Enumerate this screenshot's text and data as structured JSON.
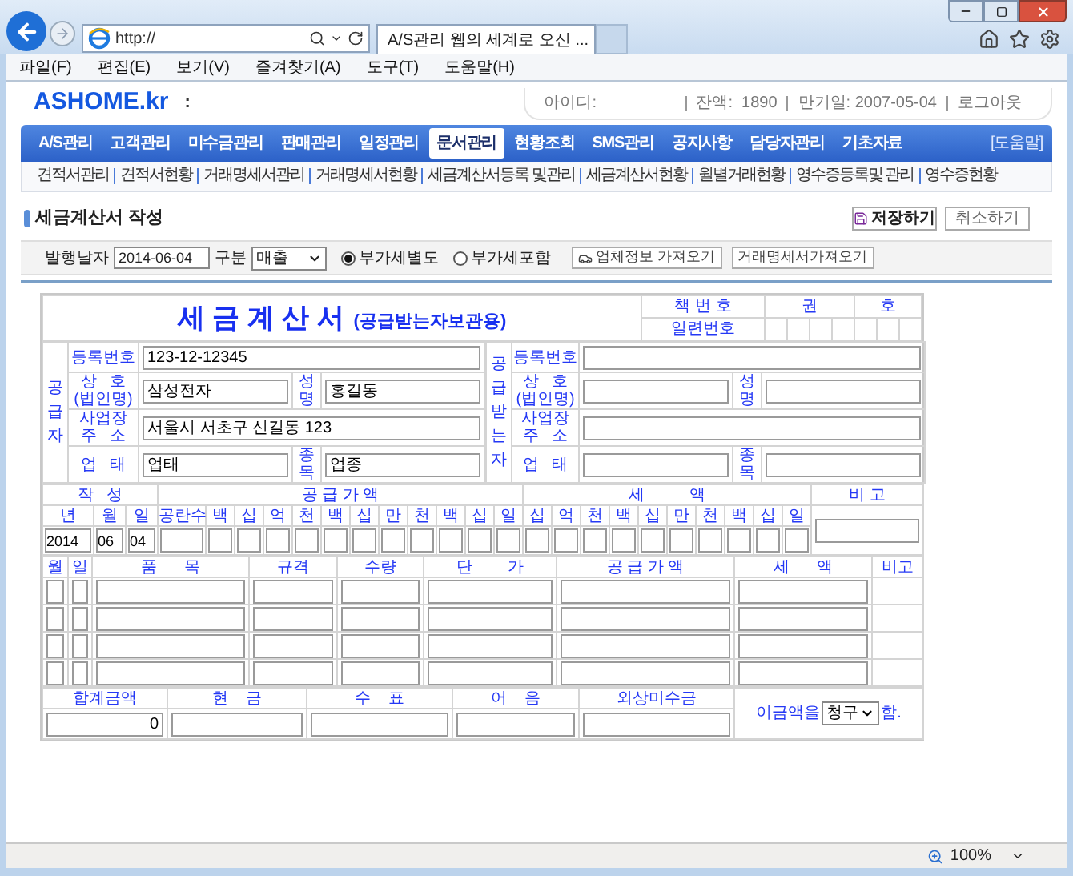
{
  "browser": {
    "address": "http://",
    "tab_title": "A/S관리 웹의 세계로 오신 ...",
    "menu": [
      "파일(F)",
      "편집(E)",
      "보기(V)",
      "즐겨찾기(A)",
      "도구(T)",
      "도움말(H)"
    ],
    "zoom": "100%"
  },
  "header": {
    "logo": "ASHOME.kr",
    "separator": ":",
    "id_label": "아이디:",
    "account": [
      "잔액:  1890",
      "만기일: 2007-05-04",
      "로그아웃"
    ]
  },
  "nav": [
    {
      "label": "A/S관리",
      "selected": false
    },
    {
      "label": "고객관리",
      "selected": false
    },
    {
      "label": "미수금관리",
      "selected": false
    },
    {
      "label": "판매관리",
      "selected": false
    },
    {
      "label": "일정관리",
      "selected": false
    },
    {
      "label": "문서관리",
      "selected": true
    },
    {
      "label": "현황조회",
      "selected": false
    },
    {
      "label": "SMS관리",
      "selected": false
    },
    {
      "label": "공지사항",
      "selected": false
    },
    {
      "label": "담당자관리",
      "selected": false
    },
    {
      "label": "기초자료",
      "selected": false
    }
  ],
  "help": "[도움말]",
  "subnav": [
    "견적서관리",
    "견적서현황",
    "거래명세서관리",
    "거래명세서현황",
    "세금계산서등록 및관리",
    "세금계산서현황",
    "월별거래현황",
    "영수증등록및 관리",
    "영수증현황"
  ],
  "page_title": "세금계산서 작성",
  "actions": [
    {
      "label": "저장하기",
      "kind": "save"
    },
    {
      "label": "취소하기",
      "kind": "plain"
    }
  ],
  "toolbar": {
    "date_label": "발행날자",
    "date": "2014-06-04",
    "type_label": "구분",
    "type": "매출",
    "vat_options": [
      {
        "label": "부가세별도",
        "selected": true
      },
      {
        "label": "부가세포함",
        "selected": false
      }
    ],
    "buttons": [
      {
        "label": "업체정보 가져오기",
        "kind": "icon"
      },
      {
        "label": "거래명세서가져오기",
        "kind": "plain"
      }
    ]
  },
  "invoice": {
    "title": "세 금 계 산 서",
    "subtitle": "(공급받는자보관용)",
    "book_label": "책 번 호",
    "volume_label": "권",
    "number_label": "호",
    "serial_label": "일련번호",
    "parties": [
      {
        "side": "공급자",
        "reg_label": "등록번호",
        "reg": "123-12-12345",
        "company_label": [
          "상   호",
          "(법인명)"
        ],
        "company": "삼성전자",
        "name_label": "성명",
        "name": "홍길동",
        "address_label": [
          "사업장",
          "주   소"
        ],
        "address": "서울시 서초구 신길동 123",
        "business_label": "업   태",
        "business": "업태",
        "item_label": "종목",
        "item": "업종"
      },
      {
        "side": "공급받는자",
        "reg_label": "등록번호",
        "company_label": [
          "상   호",
          "(법인명)"
        ],
        "name_label": "성명",
        "address_label": [
          "사업장",
          "주   소"
        ],
        "business_label": "업   태",
        "item_label": "종목"
      }
    ],
    "amounts": {
      "headers": [
        "작   성",
        "공 급 가 액",
        "세          액",
        "비 고"
      ],
      "date_units": [
        "년",
        "월",
        "일"
      ],
      "blank_label": "공란수",
      "supply_digits": [
        "백",
        "십",
        "억",
        "천",
        "백",
        "십",
        "만",
        "천",
        "백",
        "십",
        "일"
      ],
      "tax_digits": [
        "십",
        "억",
        "천",
        "백",
        "십",
        "만",
        "천",
        "백",
        "십",
        "일"
      ],
      "date_values": [
        "2014",
        "06",
        "04"
      ]
    },
    "items": {
      "columns": [
        "월",
        "일",
        "품      목",
        "규격",
        "수량",
        "단        가",
        "공 급 가 액",
        "세      액",
        "비고"
      ],
      "rows": [
        {
          "kind": "blank"
        },
        {
          "kind": "blank"
        },
        {
          "kind": "blank"
        },
        {
          "kind": "blank"
        }
      ]
    },
    "totals": {
      "columns": [
        "합계금액",
        "현    금",
        "수    표",
        "어    음",
        "외상미수금"
      ],
      "values": [
        "0"
      ],
      "phrase_before": "이금액을",
      "claim": "청구",
      "phrase_after": "함."
    }
  }
}
